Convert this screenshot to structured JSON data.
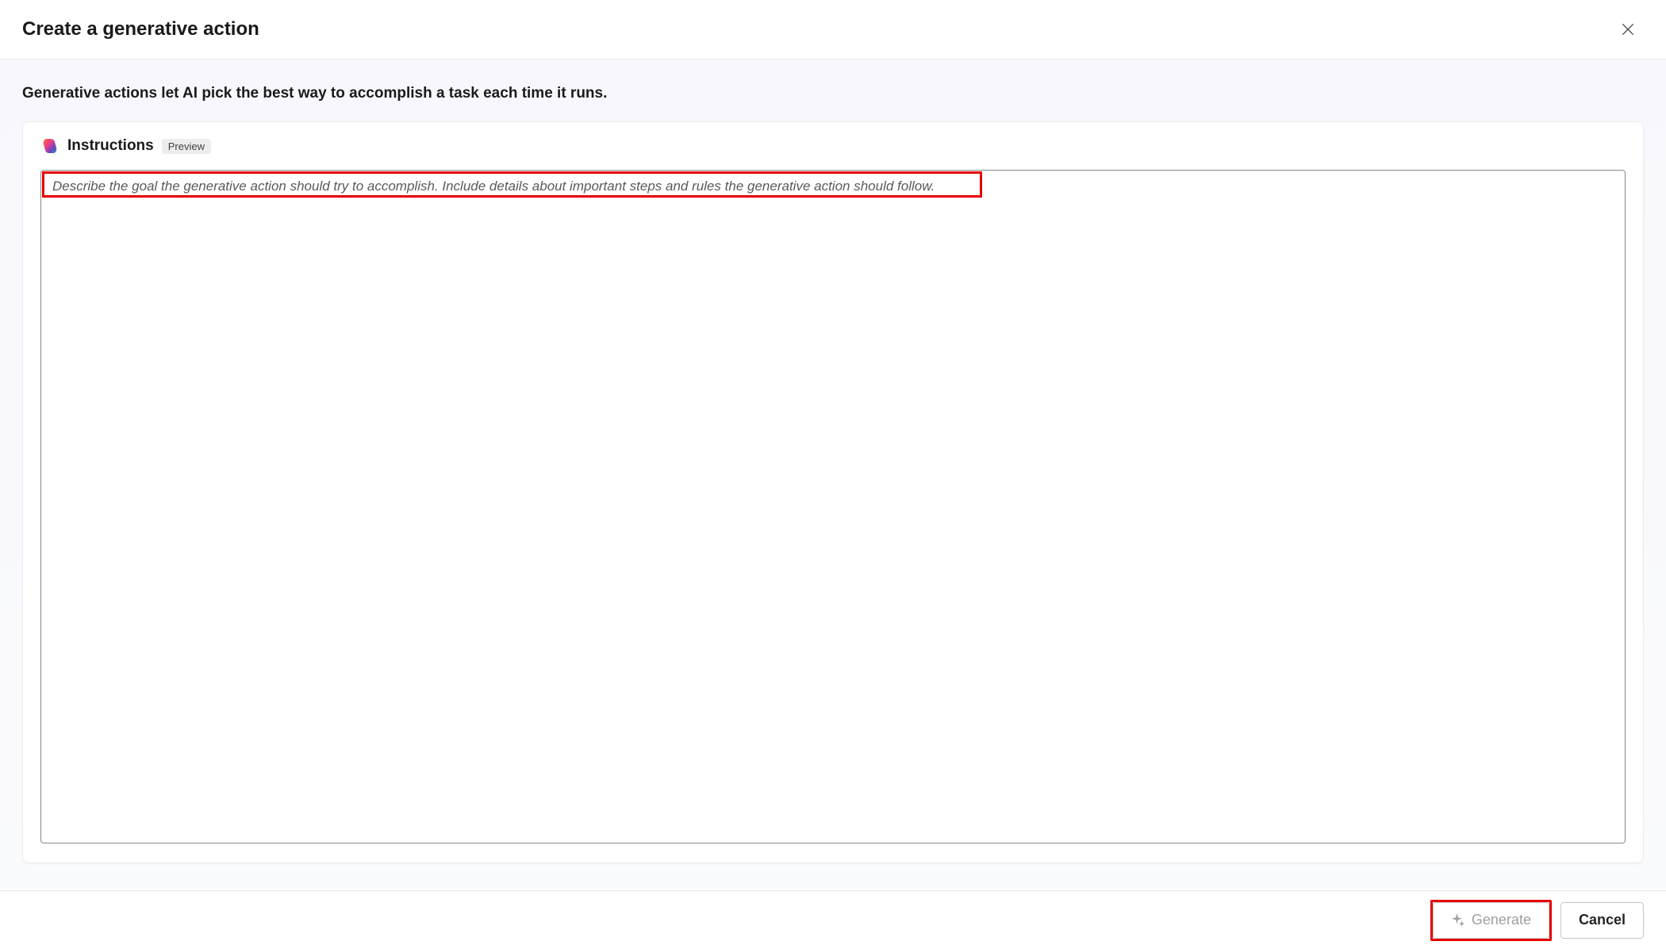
{
  "header": {
    "title": "Create a generative action"
  },
  "intro": "Generative actions let AI pick the best way to accomplish a task each time it runs.",
  "card": {
    "title": "Instructions",
    "badge": "Preview",
    "placeholder": "Describe the goal the generative action should try to accomplish. Include details about important steps and rules the generative action should follow.",
    "value": ""
  },
  "footer": {
    "generate": "Generate",
    "cancel": "Cancel"
  }
}
